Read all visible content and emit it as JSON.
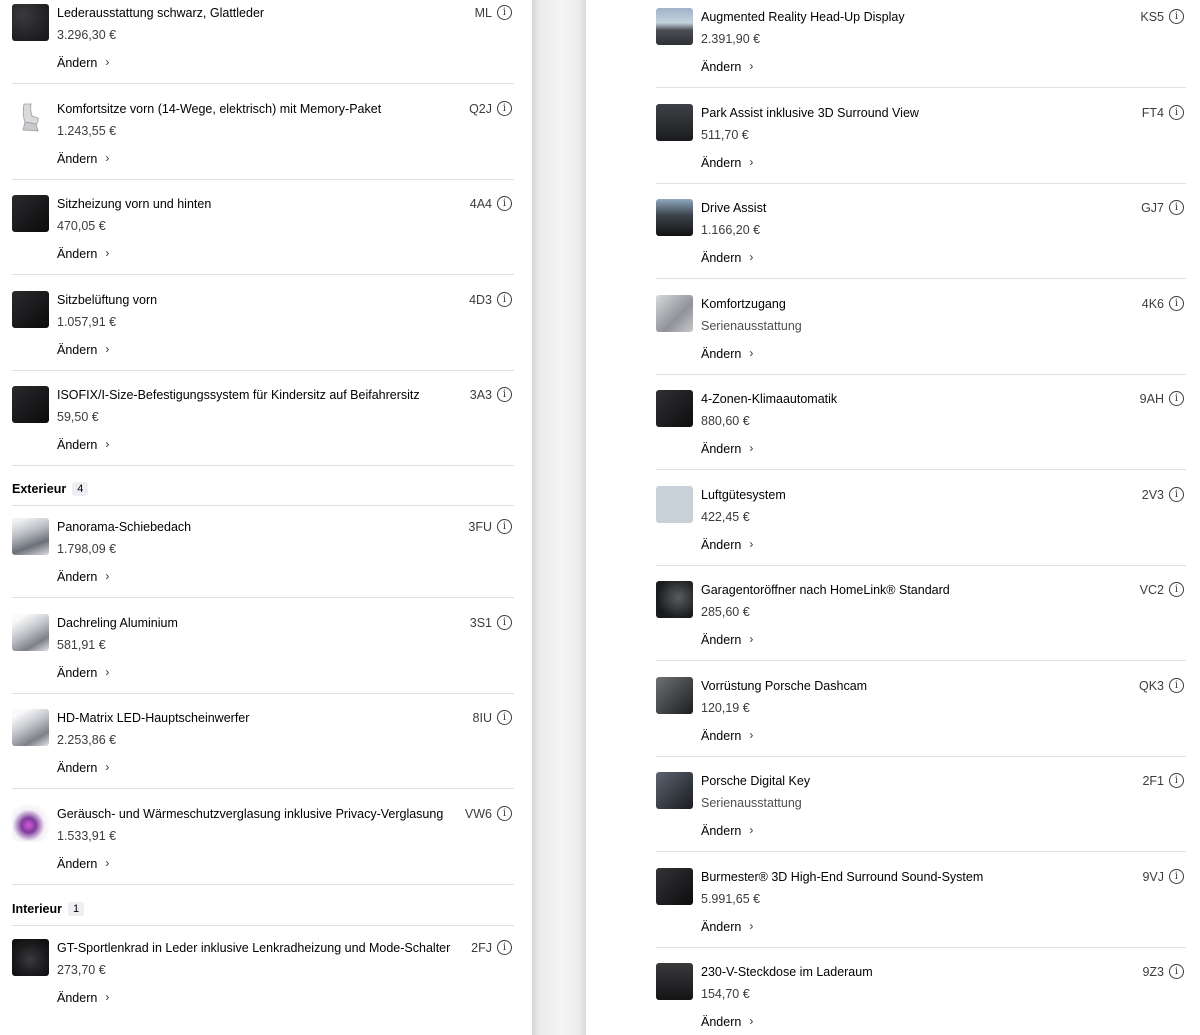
{
  "left": {
    "top_items": [
      {
        "name": "Lederausstattung schwarz, Glattleder",
        "price": "3.296,30 €",
        "code": "ML",
        "change": "Ändern",
        "thumb": "leather"
      },
      {
        "name": "Komfortsitze vorn (14-Wege, elektrisch) mit Memory-Paket",
        "price": "1.243,55 €",
        "code": "Q2J",
        "change": "Ändern",
        "thumb": "seat"
      },
      {
        "name": "Sitzheizung vorn und hinten",
        "price": "470,05 €",
        "code": "4A4",
        "change": "Ändern",
        "thumb": "dark"
      },
      {
        "name": "Sitzbelüftung vorn",
        "price": "1.057,91 €",
        "code": "4D3",
        "change": "Ändern",
        "thumb": "dark"
      },
      {
        "name": "ISOFIX/I-Size-Befestigungssystem für Kindersitz auf Beifahrersitz",
        "price": "59,50 €",
        "code": "3A3",
        "change": "Ändern",
        "thumb": "dark"
      }
    ],
    "exterieur": {
      "title": "Exterieur",
      "count": "4",
      "items": [
        {
          "name": "Panorama-Schiebedach",
          "price": "1.798,09 €",
          "code": "3FU",
          "change": "Ändern",
          "thumb": "roof"
        },
        {
          "name": "Dachreling Aluminium",
          "price": "581,91 €",
          "code": "3S1",
          "change": "Ändern",
          "thumb": "car"
        },
        {
          "name": "HD-Matrix LED-Hauptscheinwerfer",
          "price": "2.253,86 €",
          "code": "8IU",
          "change": "Ändern",
          "thumb": "car"
        },
        {
          "name": "Geräusch- und Wärmeschutzverglasung inklusive Privacy-Verglasung",
          "price": "1.533,91 €",
          "code": "VW6",
          "change": "Ändern",
          "thumb": "glass"
        }
      ]
    },
    "interieur": {
      "title": "Interieur",
      "count": "1",
      "items": [
        {
          "name": "GT-Sportlenkrad in Leder inklusive Lenkradheizung und Mode-Schalter",
          "price": "273,70 €",
          "code": "2FJ",
          "change": "Ändern",
          "thumb": "wheel"
        }
      ]
    }
  },
  "right": {
    "items": [
      {
        "name": "Augmented Reality Head-Up Display",
        "price": "2.391,90 €",
        "code": "KS5",
        "change": "Ändern",
        "thumb": "road"
      },
      {
        "name": "Park Assist inklusive 3D Surround View",
        "price": "511,70 €",
        "code": "FT4",
        "change": "Ändern",
        "thumb": "screen"
      },
      {
        "name": "Drive Assist",
        "price": "1.166,20 €",
        "code": "GJ7",
        "change": "Ändern",
        "thumb": "cockpit"
      },
      {
        "name": "Komfortzugang",
        "price": "Serienausstattung",
        "code": "4K6",
        "change": "Ändern",
        "thumb": "handle",
        "standard": true
      },
      {
        "name": "4-Zonen-Klimaautomatik",
        "price": "880,60 €",
        "code": "9AH",
        "change": "Ändern",
        "thumb": "vent"
      },
      {
        "name": "Luftgütesystem",
        "price": "422,45 €",
        "code": "2V3",
        "change": "Ändern",
        "thumb": "air"
      },
      {
        "name": "Garagentoröffner nach HomeLink® Standard",
        "price": "285,60 €",
        "code": "VC2",
        "change": "Ändern",
        "thumb": "mirror"
      },
      {
        "name": "Vorrüstung Porsche Dashcam",
        "price": "120,19 €",
        "code": "QK3",
        "change": "Ändern",
        "thumb": "cam"
      },
      {
        "name": "Porsche Digital Key",
        "price": "Serienausstattung",
        "code": "2F1",
        "change": "Ändern",
        "thumb": "phone",
        "standard": true
      },
      {
        "name": "Burmester® 3D High-End Surround Sound-System",
        "price": "5.991,65 €",
        "code": "9VJ",
        "change": "Ändern",
        "thumb": "speaker"
      },
      {
        "name": "230-V-Steckdose im Laderaum",
        "price": "154,70 €",
        "code": "9Z3",
        "change": "Ändern",
        "thumb": "socket"
      }
    ]
  },
  "icons": {
    "info": "info-icon",
    "chevron": "chevron-right-icon"
  },
  "colors": {
    "text": "#010205",
    "divider": "#e0e0e2",
    "badge_bg": "#eeeff2"
  }
}
